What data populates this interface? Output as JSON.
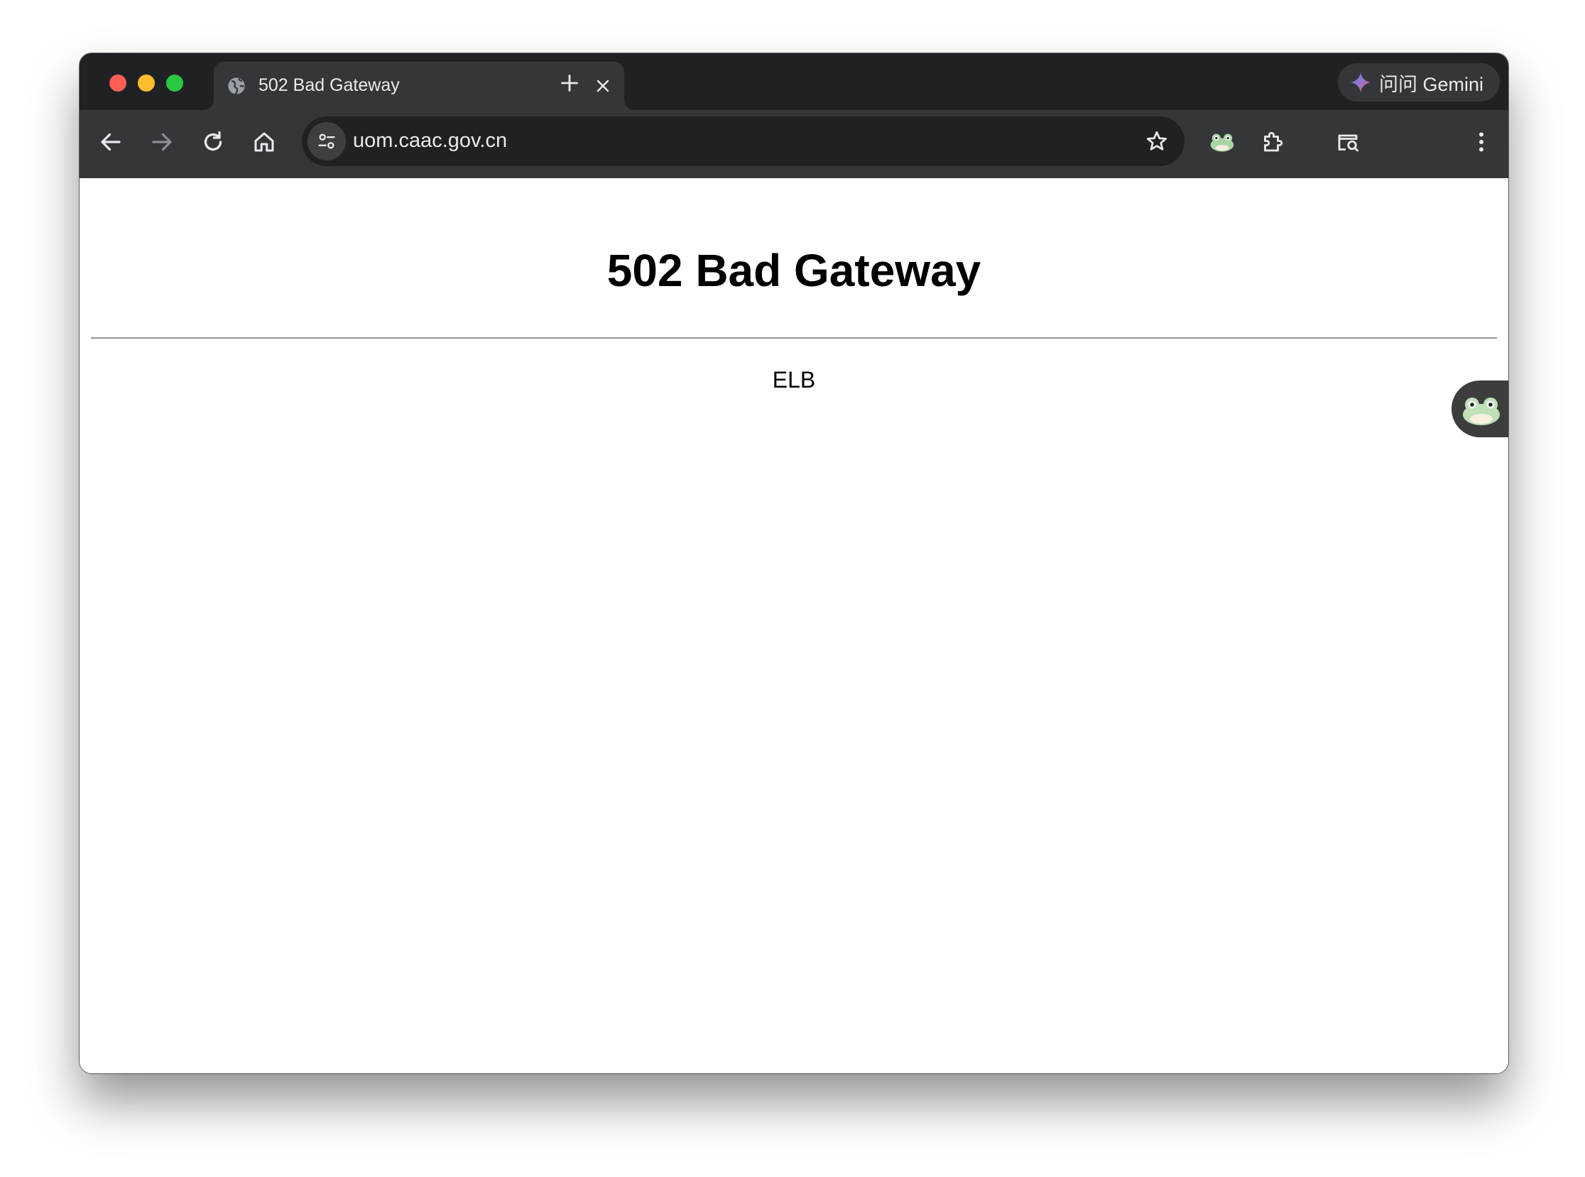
{
  "browser": {
    "tab": {
      "title": "502 Bad Gateway",
      "favicon": "globe-icon"
    },
    "gemini_button": {
      "label": "问问 Gemini",
      "icon": "gemini-sparkle-icon"
    },
    "toolbar": {
      "back_icon": "arrow-left-icon",
      "forward_icon": "arrow-right-icon",
      "reload_icon": "reload-icon",
      "home_icon": "home-icon"
    },
    "omnibox": {
      "url": "uom.caac.gov.cn",
      "site_info_icon": "tune-icon",
      "bookmark_icon": "star-icon"
    },
    "extensions": [
      "frog-extension-icon",
      "puzzle-icon",
      "search-tab-icon"
    ],
    "colors": {
      "tabstrip": "#202124",
      "toolbar": "#35363a",
      "omnibox": "#202124"
    }
  },
  "page": {
    "title": "502 Bad Gateway",
    "server": "ELB"
  }
}
